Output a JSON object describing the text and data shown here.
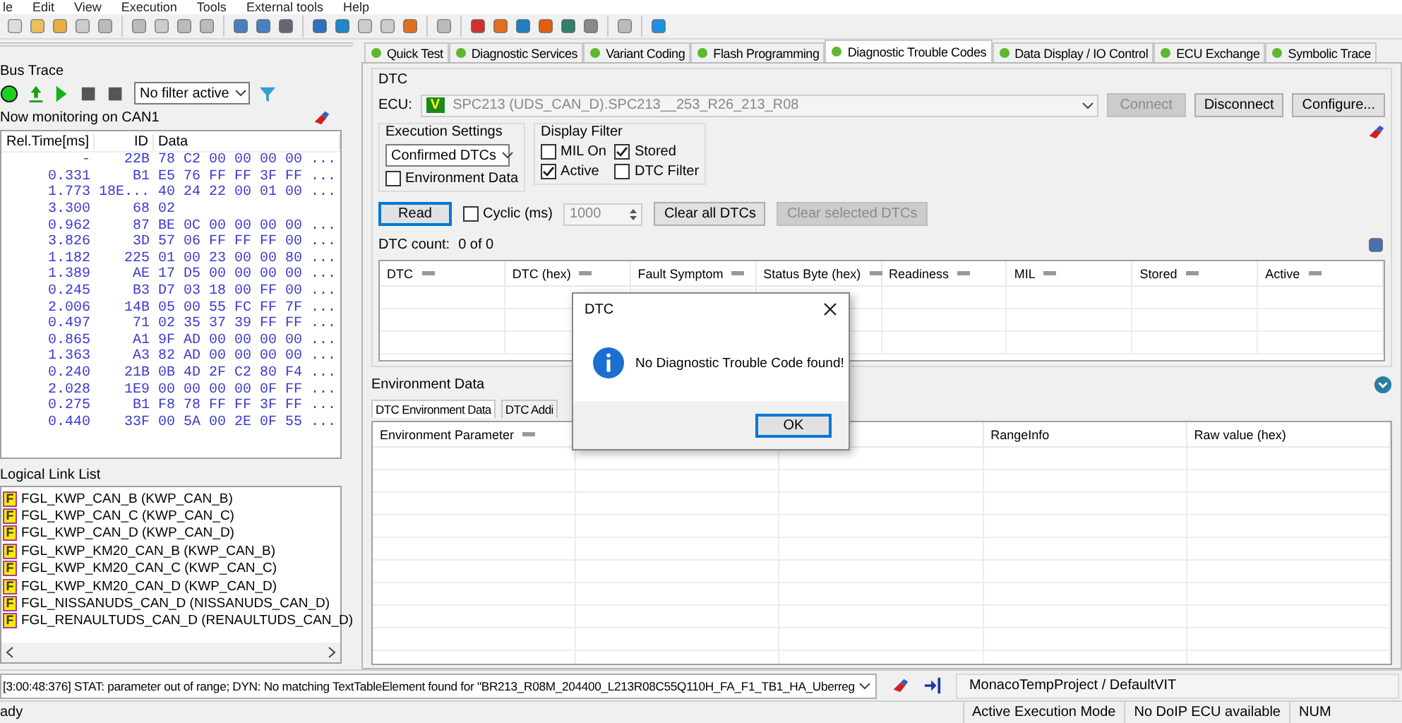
{
  "menu": [
    "le",
    "Edit",
    "View",
    "Execution",
    "Tools",
    "External tools",
    "Help"
  ],
  "bus_trace": {
    "title": "Bus Trace",
    "filter": "No filter active",
    "monitoring": "Now monitoring on CAN1",
    "columns": [
      "Rel.Time[ms]",
      "ID",
      "Data"
    ],
    "rows": [
      {
        "time": "-",
        "id": "22B",
        "data": "78 C2 00 00 00 00 ..."
      },
      {
        "time": "0.331",
        "id": "B1",
        "data": "E5 76 FF FF 3F FF ..."
      },
      {
        "time": "1.773",
        "id": "18E...",
        "data": "40 24 22 00 01 00 ..."
      },
      {
        "time": "3.300",
        "id": "68",
        "data": "02"
      },
      {
        "time": "0.962",
        "id": "87",
        "data": "BE 0C 00 00 00 00 ..."
      },
      {
        "time": "3.826",
        "id": "3D",
        "data": "57 06 FF FF FF 00 ..."
      },
      {
        "time": "1.182",
        "id": "225",
        "data": "01 00 23 00 00 80 ..."
      },
      {
        "time": "1.389",
        "id": "AE",
        "data": "17 D5 00 00 00 00 ..."
      },
      {
        "time": "0.245",
        "id": "B3",
        "data": "D7 03 18 00 FF 00 ..."
      },
      {
        "time": "2.006",
        "id": "14B",
        "data": "05 00 55 FC FF 7F ..."
      },
      {
        "time": "0.497",
        "id": "71",
        "data": "02 35 37 39 FF FF ..."
      },
      {
        "time": "0.865",
        "id": "A1",
        "data": "9F AD 00 00 00 00 ..."
      },
      {
        "time": "1.363",
        "id": "A3",
        "data": "82 AD 00 00 00 00 ..."
      },
      {
        "time": "0.240",
        "id": "21B",
        "data": "0B 4D 2F C2 80 F4 ..."
      },
      {
        "time": "2.028",
        "id": "1E9",
        "data": "00 00 00 00 0F FF ..."
      },
      {
        "time": "0.275",
        "id": "B1",
        "data": "F8 78 FF FF 3F FF ..."
      },
      {
        "time": "0.440",
        "id": "33F",
        "data": "00 5A 00 2E 0F 55 ..."
      }
    ]
  },
  "logical_links": {
    "title": "Logical Link List",
    "items": [
      {
        "badge": "F",
        "label": "FGL_KWP_CAN_B (KWP_CAN_B)"
      },
      {
        "badge": "F",
        "label": "FGL_KWP_CAN_C (KWP_CAN_C)"
      },
      {
        "badge": "F",
        "label": "FGL_KWP_CAN_D (KWP_CAN_D)"
      },
      {
        "badge": "F",
        "label": "FGL_KWP_KM20_CAN_B (KWP_CAN_B)"
      },
      {
        "badge": "F",
        "label": "FGL_KWP_KM20_CAN_C (KWP_CAN_C)"
      },
      {
        "badge": "F",
        "label": "FGL_KWP_KM20_CAN_D (KWP_CAN_D)"
      },
      {
        "badge": "F",
        "label": "FGL_NISSANUDS_CAN_D (NISSANUDS_CAN_D)"
      },
      {
        "badge": "F",
        "label": "FGL_RENAULTUDS_CAN_D (RENAULTUDS_CAN_D)"
      }
    ]
  },
  "tabs": [
    {
      "label": "Quick Test",
      "selected": false,
      "color": "#5cb82e"
    },
    {
      "label": "Diagnostic Services",
      "selected": false,
      "color": "#5cb82e"
    },
    {
      "label": "Variant Coding",
      "selected": false,
      "color": "#5cb82e"
    },
    {
      "label": "Flash Programming",
      "selected": false,
      "color": "#5cb82e"
    },
    {
      "label": "Diagnostic Trouble Codes",
      "selected": true,
      "color": "#5cb82e"
    },
    {
      "label": "Data Display / IO Control",
      "selected": false,
      "color": "#5cb82e"
    },
    {
      "label": "ECU Exchange",
      "selected": false,
      "color": "#5cb82e"
    },
    {
      "label": "Symbolic Trace",
      "selected": false,
      "color": "#5cb82e"
    }
  ],
  "dtc": {
    "title": "DTC",
    "ecu_label": "ECU:",
    "ecu_badge": "V",
    "ecu": "SPC213 (UDS_CAN_D).SPC213__253_R26_213_R08",
    "ecu_buttons": [
      {
        "label": "Connect",
        "disabled": true
      },
      {
        "label": "Disconnect",
        "disabled": false
      },
      {
        "label": "Configure...",
        "disabled": false
      }
    ],
    "execution_settings": {
      "title": "Execution Settings",
      "mode": "Confirmed DTCs",
      "environment_data": {
        "label": "Environment Data",
        "checked": false
      }
    },
    "display_filter": {
      "title": "Display Filter",
      "options": [
        {
          "label": "MIL On",
          "checked": false
        },
        {
          "label": "Stored",
          "checked": true
        },
        {
          "label": "Active",
          "checked": true
        },
        {
          "label": "DTC Filter",
          "checked": false
        }
      ]
    },
    "read_button": "Read",
    "cyclic": {
      "label": "Cyclic (ms)",
      "checked": false,
      "value": "1000"
    },
    "action_buttons": [
      {
        "label": "Clear all DTCs",
        "disabled": false
      },
      {
        "label": "Clear selected DTCs",
        "disabled": true
      }
    ],
    "count_label": "DTC count:",
    "count": "0 of 0",
    "columns": [
      "DTC",
      "DTC (hex)",
      "Fault Symptom",
      "Status Byte (hex)",
      "Readiness",
      "MIL",
      "Stored",
      "Active"
    ]
  },
  "environment": {
    "title": "Environment Data",
    "tabs": [
      {
        "label": "DTC Environment Data",
        "selected": true
      },
      {
        "label": "DTC Addi",
        "selected": false
      }
    ],
    "columns": [
      "Environment Parameter",
      "RangeInfo",
      "Raw value (hex)"
    ]
  },
  "dialog": {
    "title": "DTC",
    "message": "No Diagnostic Trouble Code found!",
    "button": "OK"
  },
  "message_line": "[3:00:48:376] STAT: parameter out of range; DYN: No matching TextTableElement found for \"BR213_R08M_204400_L213R08C55Q110H_FA_F1_TB1_HA_Uberreg",
  "project": "MonacoTempProject / DefaultVIT",
  "status_bar": {
    "left": "ady",
    "panes": [
      "Active Execution Mode",
      "No DoIP ECU available",
      "NUM"
    ]
  }
}
